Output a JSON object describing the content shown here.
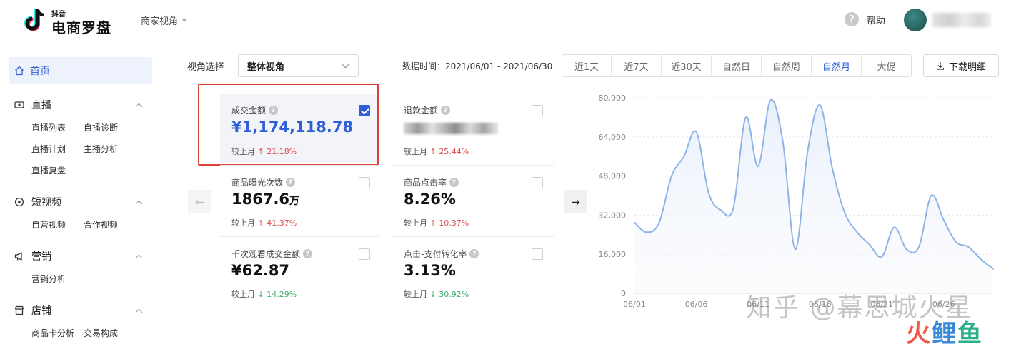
{
  "header": {
    "logo_small": "抖音",
    "logo_big": "电商罗盘",
    "shop_view": "商家视角",
    "help_label": "帮助"
  },
  "sidebar": {
    "home": "首页",
    "groups": [
      {
        "label": "直播",
        "icon": "live-icon",
        "items": [
          "直播列表",
          "自播诊断",
          "直播计划",
          "主播分析",
          "直播复盘"
        ]
      },
      {
        "label": "短视频",
        "icon": "video-icon",
        "items": [
          "自营视频",
          "合作视频"
        ]
      },
      {
        "label": "营销",
        "icon": "megaphone-icon",
        "items": [
          "营销分析"
        ]
      },
      {
        "label": "店铺",
        "icon": "store-icon",
        "items": [
          "商品卡分析",
          "交易构成"
        ]
      }
    ]
  },
  "controls": {
    "view_label": "视角选择",
    "view_value": "整体视角",
    "data_time": "数据时间：2021/06/01 - 2021/06/30",
    "range_tabs": [
      "近1天",
      "近7天",
      "近30天",
      "自然日",
      "自然周",
      "自然月",
      "大促"
    ],
    "active_range": "自然月",
    "download_label": "下载明细"
  },
  "cards": [
    {
      "label": "成交金额",
      "value": "¥1,174,118.78",
      "compare_prefix": "较上月",
      "change": "↑ 21.18%",
      "dir": "up",
      "checked": true
    },
    {
      "label": "退款金额",
      "value": "",
      "compare_prefix": "较上月",
      "change": "↑ 25.44%",
      "dir": "up",
      "checked": false
    },
    {
      "label": "商品曝光次数",
      "value": "1867.6",
      "unit": "万",
      "compare_prefix": "较上月",
      "change": "↑ 41.37%",
      "dir": "up",
      "checked": false
    },
    {
      "label": "商品点击率",
      "value": "8.26%",
      "compare_prefix": "较上月",
      "change": "↑ 10.37%",
      "dir": "up",
      "checked": false
    },
    {
      "label": "千次观看成交金额",
      "value": "¥62.87",
      "compare_prefix": "较上月",
      "change": "↓ 14.29%",
      "dir": "down",
      "checked": false
    },
    {
      "label": "点击-支付转化率",
      "value": "3.13%",
      "compare_prefix": "较上月",
      "change": "↓ 30.92%",
      "dir": "down",
      "checked": false
    }
  ],
  "chart_data": {
    "type": "area",
    "y_ticks": [
      "80,000",
      "64,000",
      "48,000",
      "32,000",
      "16,000",
      "0"
    ],
    "ylim": [
      0,
      80000
    ],
    "x_ticks": [
      "06/01",
      "06/06",
      "06/11",
      "06/16",
      "06/21",
      "06/26"
    ],
    "series": [
      {
        "x": [
          1,
          2,
          3,
          4,
          5,
          6,
          7,
          8,
          9,
          10,
          11,
          12,
          13,
          14,
          15,
          16,
          17,
          18,
          19,
          20,
          21,
          22,
          23,
          24,
          25,
          26,
          27,
          28,
          29,
          30
        ],
        "values": [
          29000,
          25000,
          29000,
          48000,
          56000,
          66000,
          41000,
          34000,
          35000,
          72000,
          52000,
          79000,
          62000,
          18000,
          58000,
          77000,
          51000,
          33000,
          25000,
          20000,
          15000,
          27000,
          18000,
          19000,
          40000,
          30000,
          21000,
          19000,
          14000,
          10000
        ]
      }
    ]
  },
  "watermark": {
    "text": "知乎 @幕思城火星",
    "logo_chars": [
      "火",
      "鲤",
      "鱼"
    ]
  },
  "colors": {
    "accent": "#2d5fd6",
    "up": "#e04b4b",
    "down": "#3fb06a",
    "highlight_frame": "#e0403a",
    "line": "#8eb4e8"
  }
}
